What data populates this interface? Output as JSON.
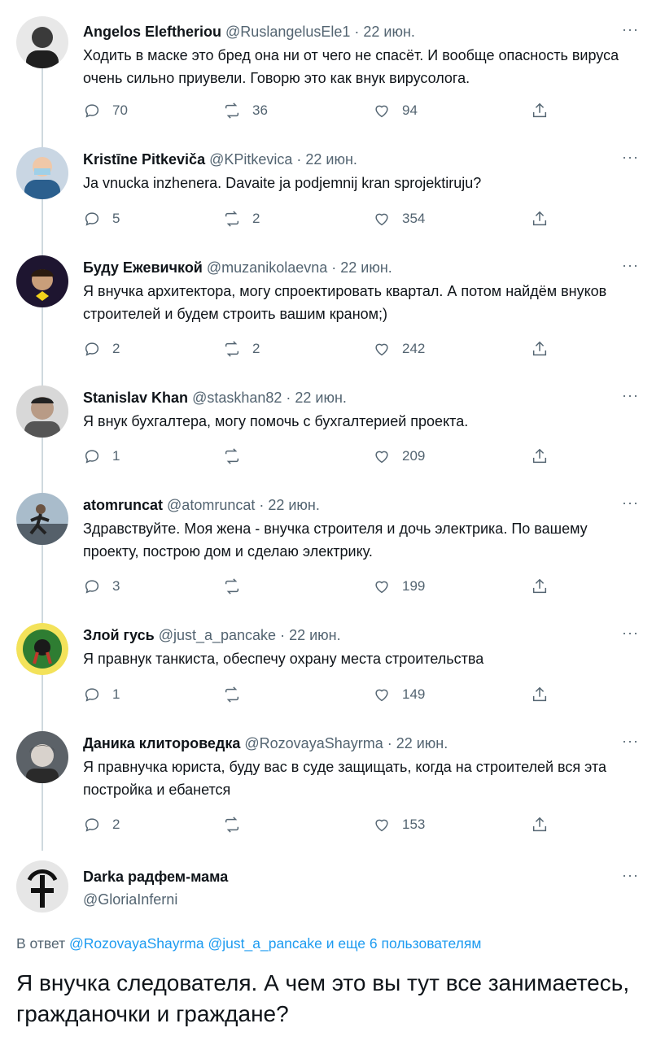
{
  "tweets": [
    {
      "name": "Angelos Eleftheriou",
      "handle": "@RuslangelusEle1",
      "sep": " · ",
      "time": "22 июн.",
      "text": "Ходить в маске это бред она ни от чего не спасёт. И вообще опасность вируса очень сильно приувели. Говорю это как внук вирусолога.",
      "replies": "70",
      "retweets": "36",
      "likes": "94",
      "avatar_color": "#3a3a3a"
    },
    {
      "name": "Kristīne Pitkeviča",
      "handle": "@KPitkevica",
      "sep": " · ",
      "time": "22 июн.",
      "text": "Ja vnucka inzhenera. Davaite ja podjemnij kran sprojektiruju?",
      "replies": "5",
      "retweets": "2",
      "likes": "354",
      "avatar_color": "#2b5f8e"
    },
    {
      "name": "Буду Ежевичкой",
      "handle": "@muzanikolaevna",
      "sep": " · ",
      "time": "22 июн.",
      "text": "Я внучка архитектора, могу спроектировать квартал. А потом найдём внуков строителей и будем строить вашим краном;)",
      "replies": "2",
      "retweets": "2",
      "likes": "242",
      "avatar_color": "#2a1f3d"
    },
    {
      "name": "Stanislav Khan",
      "handle": "@staskhan82",
      "sep": " · ",
      "time": "22 июн.",
      "text": "Я внук бухгалтера, могу помочь с бухгалтерией проекта.",
      "replies": "1",
      "retweets": "",
      "likes": "209",
      "avatar_color": "#8a8a8a"
    },
    {
      "name": "atomruncat",
      "handle": "@atomruncat",
      "sep": " · ",
      "time": "22 июн.",
      "text": "Здравствуйте. Моя жена - внучка строителя и дочь электрика. По вашему проекту, построю дом и сделаю электрику.",
      "replies": "3",
      "retweets": "",
      "likes": "199",
      "avatar_color": "#6f8696"
    },
    {
      "name": "Злой гусь",
      "handle": "@just_a_pancake",
      "sep": " · ",
      "time": "22 июн.",
      "text": "Я правнук танкиста, обеспечу охрану места строительства",
      "replies": "1",
      "retweets": "",
      "likes": "149",
      "avatar_color": "#2e7d32"
    },
    {
      "name": "Даника клитороведка",
      "handle": "@RozovayaShayrma",
      "sep": " · ",
      "time": "22 июн.",
      "text": "Я правнучка юриста, буду вас в суде защищать, когда на строителей вся эта постройка и ебанется",
      "replies": "2",
      "retweets": "",
      "likes": "153",
      "avatar_color": "#4a4f55"
    }
  ],
  "main": {
    "name": "Darka радфем-мама",
    "handle": "@GloriaInferni",
    "reply_prefix": "В ответ ",
    "reply_user1": "@RozovayaShayrma",
    "reply_user2": "@just_a_pancake",
    "reply_suffix": " и еще 6 пользователям",
    "text": "Я внучка следователя. А чем это вы тут все занимаетесь, гражданочки и граждане?"
  },
  "more_label": "···",
  "icons": [
    "reply-icon",
    "retweet-icon",
    "like-icon",
    "share-icon"
  ],
  "colors": {
    "link": "#1d9bf0",
    "secondary": "#536471",
    "thread_line": "#cfd9de"
  }
}
